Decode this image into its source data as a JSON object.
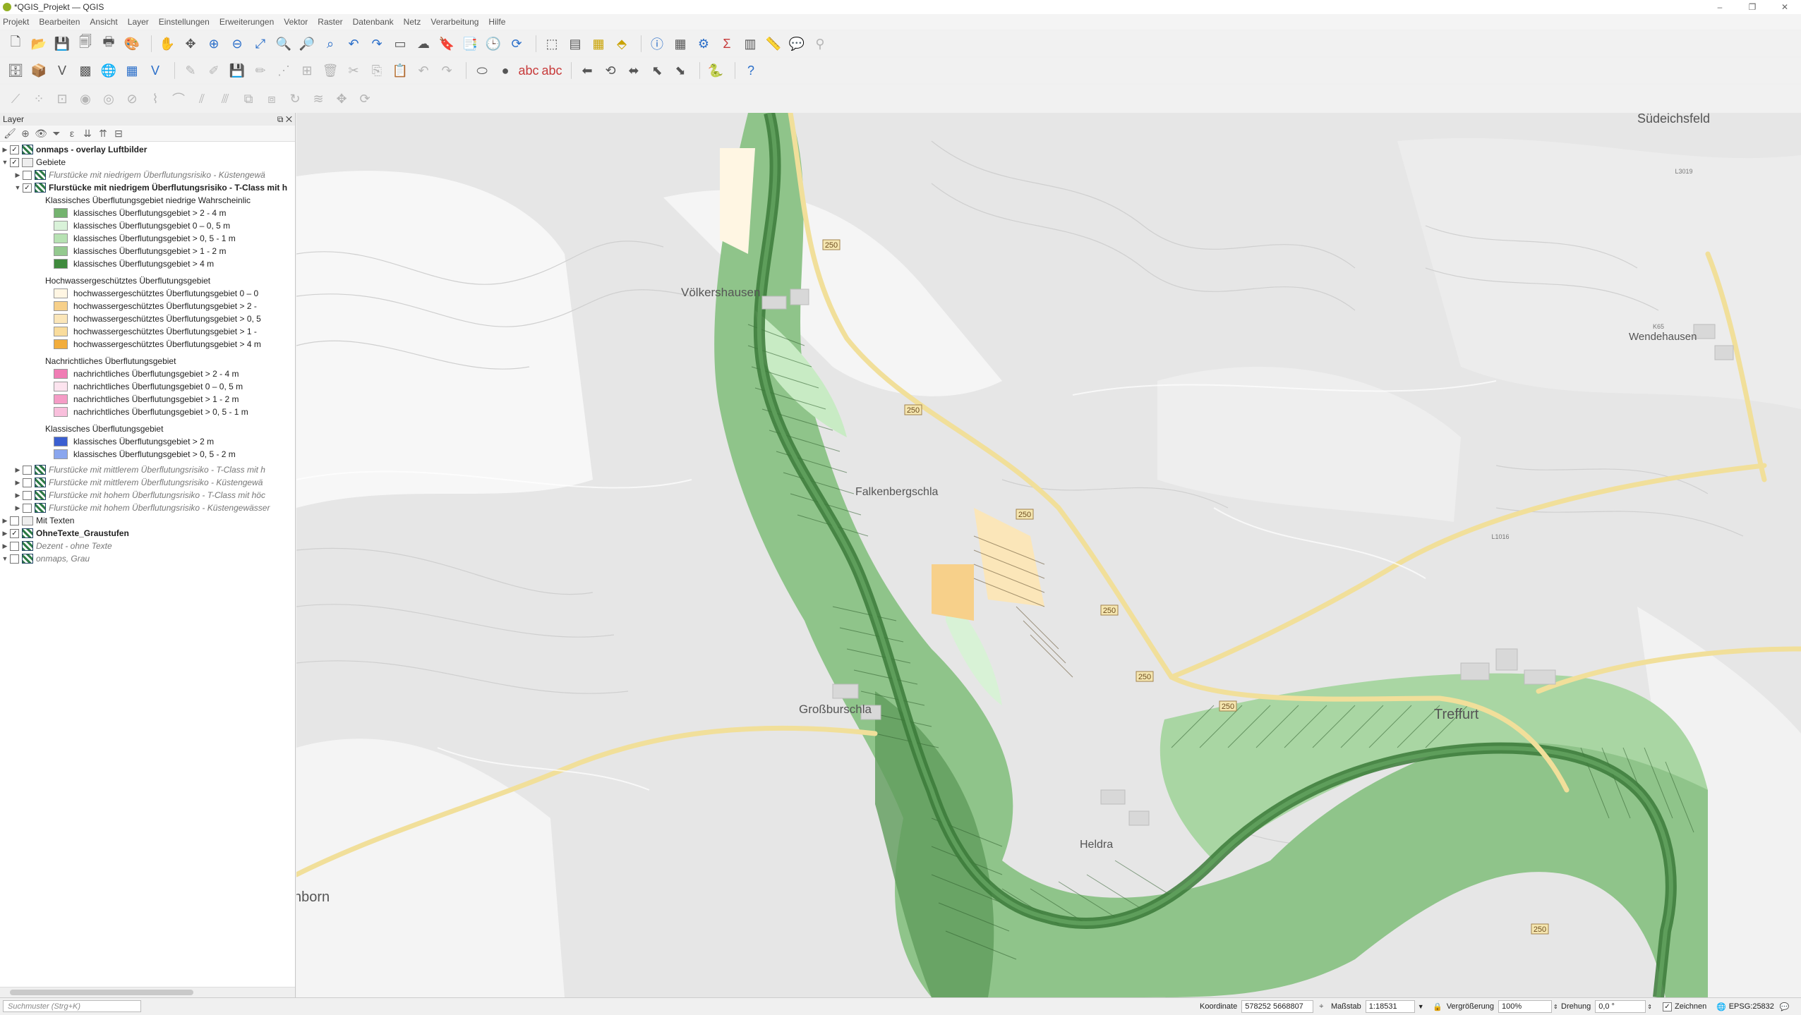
{
  "window": {
    "title": "*QGIS_Projekt — QGIS",
    "minimize": "–",
    "maximize": "❐",
    "close": "✕"
  },
  "menu": [
    "Projekt",
    "Bearbeiten",
    "Ansicht",
    "Layer",
    "Einstellungen",
    "Erweiterungen",
    "Vektor",
    "Raster",
    "Datenbank",
    "Netz",
    "Verarbeitung",
    "Hilfe"
  ],
  "panel": {
    "title": "Layer",
    "float": "⧉",
    "close": "✕",
    "search_placeholder": "Suchmuster (Strg+K)"
  },
  "layers": {
    "l1": "onmaps - overlay Luftbilder",
    "l2": "Gebiete",
    "l3": "Flurstücke mit niedrigem Überflutungsrisiko - Küstengewä",
    "l4": "Flurstücke mit niedrigem Überflutungsrisiko - T-Class mit h",
    "g1": "Klassisches Überflutungsgebiet niedrige Wahrscheinlic",
    "g1a": "klassisches Überflutungsgebiet > 2 - 4 m",
    "g1b": "klassisches Überflutungsgebiet 0 – 0, 5 m",
    "g1c": "klassisches Überflutungsgebiet > 0, 5 - 1 m",
    "g1d": "klassisches Überflutungsgebiet > 1 - 2 m",
    "g1e": "klassisches Überflutungsgebiet > 4 m",
    "g2": "Hochwassergeschütztes Überflutungsgebiet",
    "g2a": "hochwassergeschütztes Überflutungsgebiet 0 – 0",
    "g2b": "hochwassergeschütztes Überflutungsgebiet > 2 -",
    "g2c": "hochwassergeschütztes Überflutungsgebiet > 0, 5",
    "g2d": "hochwassergeschütztes Überflutungsgebiet > 1 -",
    "g2e": "hochwassergeschütztes Überflutungsgebiet > 4 m",
    "g3": "Nachrichtliches Überflutungsgebiet",
    "g3a": "nachrichtliches Überflutungsgebiet > 2 - 4 m",
    "g3b": "nachrichtliches Überflutungsgebiet 0 – 0, 5 m",
    "g3c": "nachrichtliches Überflutungsgebiet > 1 - 2 m",
    "g3d": "nachrichtliches Überflutungsgebiet > 0, 5 - 1 m",
    "g4": "Klassisches Überflutungsgebiet",
    "g4a": "klassisches Überflutungsgebiet > 2 m",
    "g4b": "klassisches Überflutungsgebiet > 0, 5 - 2 m",
    "l5": "Flurstücke mit mittlerem Überflutungsrisiko - T-Class mit h",
    "l6": "Flurstücke mit mittlerem Überflutungsrisiko - Küstengewä",
    "l7": "Flurstücke mit hohem Überflutungsrisiko - T-Class mit höc",
    "l8": "Flurstücke mit hohem Überflutungsrisiko - Küstengewässer",
    "l9": "Mit Texten",
    "l10": "OhneTexte_Graustufen",
    "l11": "Dezent - ohne Texte",
    "l12": "onmaps, Grau"
  },
  "colors": {
    "g1a": "#74b36f",
    "g1b": "#d9f2d9",
    "g1c": "#b7e2b3",
    "g1d": "#94c98f",
    "g1e": "#3f8a3d",
    "g2a": "#fff6e3",
    "g2b": "#f7d08a",
    "g2c": "#fbe6b9",
    "g2d": "#f9dc9c",
    "g2e": "#f2ad3c",
    "g3a": "#f07cb4",
    "g3b": "#fde4ef",
    "g3c": "#f59cc6",
    "g3d": "#f9bfdc",
    "g4a": "#3b5fd1",
    "g4b": "#8aa6ee"
  },
  "map_labels": {
    "sudeichsfeld": "Südeichsfeld",
    "volkershausen": "Völkershausen",
    "wendehausen": "Wendehausen",
    "falkenbergschla": "Falkenbergschla",
    "grossburschla": "Großburschla",
    "treffurt": "Treffurt",
    "heldra": "Heldra",
    "nborn": "nborn",
    "road250": "250",
    "l3019": "L3019",
    "l1016": "L1016",
    "k65": "K65"
  },
  "status": {
    "coord_label": "Koordinate",
    "coord_value": "578252 5668807",
    "scale_label": "Maßstab",
    "scale_value": "1:18531",
    "magnifier_label": "Vergrößerung",
    "magnifier_value": "100%",
    "rotation_label": "Drehung",
    "rotation_value": "0,0 °",
    "render_label": "Zeichnen",
    "crs": "EPSG:25832"
  }
}
